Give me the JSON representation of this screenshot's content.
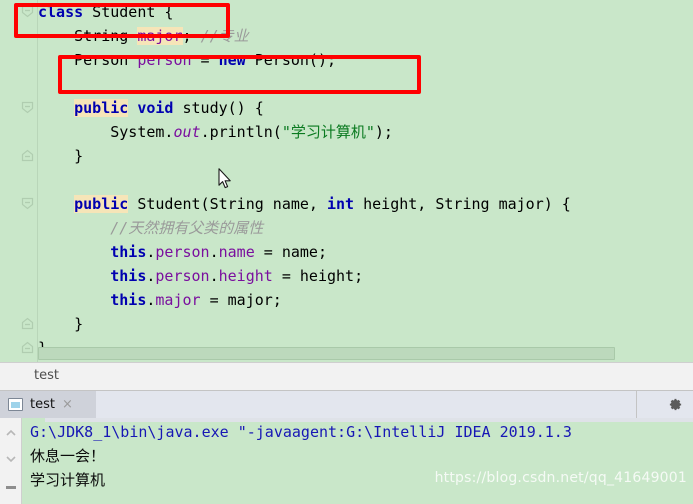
{
  "editor": {
    "background_color": "#c9e7c9",
    "lines": [
      {
        "id": "line-1",
        "fold": "collapse",
        "tokens": [
          {
            "t": "class",
            "c": "kw"
          },
          {
            "t": " Student {",
            "c": "plain"
          }
        ]
      },
      {
        "id": "line-2",
        "fold": "",
        "tokens": [
          {
            "t": "    String ",
            "c": "plain"
          },
          {
            "t": "major",
            "c": "fld-hl"
          },
          {
            "t": "; ",
            "c": "plain"
          },
          {
            "t": "//专业",
            "c": "cmt"
          }
        ]
      },
      {
        "id": "line-3",
        "fold": "",
        "tokens": [
          {
            "t": "    Person ",
            "c": "plain"
          },
          {
            "t": "person",
            "c": "fld"
          },
          {
            "t": " = ",
            "c": "plain"
          },
          {
            "t": "new",
            "c": "kw"
          },
          {
            "t": " Person();",
            "c": "plain"
          }
        ]
      },
      {
        "id": "line-4",
        "fold": "",
        "tokens": [
          {
            "t": "",
            "c": "plain"
          }
        ]
      },
      {
        "id": "line-5",
        "fold": "collapse",
        "tokens": [
          {
            "t": "    ",
            "c": "plain"
          },
          {
            "t": "public",
            "c": "kw-hl"
          },
          {
            "t": " ",
            "c": "plain"
          },
          {
            "t": "void",
            "c": "kw"
          },
          {
            "t": " study() {",
            "c": "plain"
          }
        ]
      },
      {
        "id": "line-6",
        "fold": "",
        "tokens": [
          {
            "t": "        System.",
            "c": "plain"
          },
          {
            "t": "out",
            "c": "stat"
          },
          {
            "t": ".println(",
            "c": "plain"
          },
          {
            "t": "\"学习计算机\"",
            "c": "str"
          },
          {
            "t": ");",
            "c": "plain"
          }
        ]
      },
      {
        "id": "line-7",
        "fold": "expand",
        "tokens": [
          {
            "t": "    }",
            "c": "plain"
          }
        ]
      },
      {
        "id": "line-8",
        "fold": "",
        "tokens": [
          {
            "t": "",
            "c": "plain"
          }
        ]
      },
      {
        "id": "line-9",
        "fold": "collapse",
        "tokens": [
          {
            "t": "    ",
            "c": "plain"
          },
          {
            "t": "public",
            "c": "kw-hl"
          },
          {
            "t": " Student(String name, ",
            "c": "plain"
          },
          {
            "t": "int",
            "c": "kw"
          },
          {
            "t": " height, String major) {",
            "c": "plain"
          }
        ]
      },
      {
        "id": "line-10",
        "fold": "",
        "tokens": [
          {
            "t": "        ",
            "c": "plain"
          },
          {
            "t": "//天然拥有父类的属性",
            "c": "cmt"
          }
        ]
      },
      {
        "id": "line-11",
        "fold": "",
        "tokens": [
          {
            "t": "        ",
            "c": "plain"
          },
          {
            "t": "this",
            "c": "kw"
          },
          {
            "t": ".",
            "c": "plain"
          },
          {
            "t": "person",
            "c": "fld"
          },
          {
            "t": ".",
            "c": "plain"
          },
          {
            "t": "name",
            "c": "fld"
          },
          {
            "t": " = name;",
            "c": "plain"
          }
        ]
      },
      {
        "id": "line-12",
        "fold": "",
        "tokens": [
          {
            "t": "        ",
            "c": "plain"
          },
          {
            "t": "this",
            "c": "kw"
          },
          {
            "t": ".",
            "c": "plain"
          },
          {
            "t": "person",
            "c": "fld"
          },
          {
            "t": ".",
            "c": "plain"
          },
          {
            "t": "height",
            "c": "fld"
          },
          {
            "t": " = height;",
            "c": "plain"
          }
        ]
      },
      {
        "id": "line-13",
        "fold": "",
        "tokens": [
          {
            "t": "        ",
            "c": "plain"
          },
          {
            "t": "this",
            "c": "kw"
          },
          {
            "t": ".",
            "c": "plain"
          },
          {
            "t": "major",
            "c": "fld"
          },
          {
            "t": " = major;",
            "c": "plain"
          }
        ]
      },
      {
        "id": "line-14",
        "fold": "expand",
        "tokens": [
          {
            "t": "    }",
            "c": "plain"
          }
        ]
      },
      {
        "id": "line-15",
        "fold": "expand",
        "tokens": [
          {
            "t": "}",
            "c": "plain"
          }
        ]
      }
    ]
  },
  "breadcrumb": {
    "text": "test"
  },
  "run_panel": {
    "tab": {
      "label": "test",
      "close_label": "×",
      "icon": "console-window-icon"
    },
    "settings_icon": "gear-icon"
  },
  "console": {
    "lines": [
      {
        "text": "G:\\JDK8_1\\bin\\java.exe \"-javaagent:G:\\IntelliJ IDEA 2019.1.3",
        "style": "cl-cmd"
      },
      {
        "text": "休息一会！",
        "style": "cl-out"
      },
      {
        "text": "学习计算机",
        "style": "cl-out"
      }
    ]
  },
  "watermark": {
    "text": "https://blog.csdn.net/qq_41649001"
  },
  "annotations": {
    "color": "#ff0000",
    "boxes": [
      {
        "name": "highlight-class-declaration"
      },
      {
        "name": "highlight-person-field"
      }
    ]
  }
}
